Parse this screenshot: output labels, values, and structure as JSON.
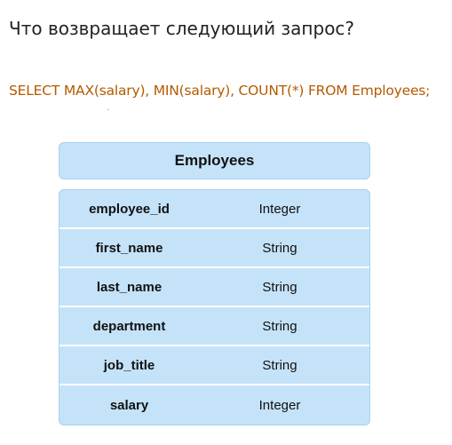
{
  "question": "Что возвращает следующий запрос?",
  "query": "SELECT MAX(salary), MIN(salary), COUNT(*) FROM Employees;",
  "table": {
    "title": "Employees",
    "fields": [
      {
        "name": "employee_id",
        "type": "Integer"
      },
      {
        "name": "first_name",
        "type": "String"
      },
      {
        "name": "last_name",
        "type": "String"
      },
      {
        "name": "department",
        "type": "String"
      },
      {
        "name": "job_title",
        "type": "String"
      },
      {
        "name": "salary",
        "type": "Integer"
      }
    ]
  }
}
